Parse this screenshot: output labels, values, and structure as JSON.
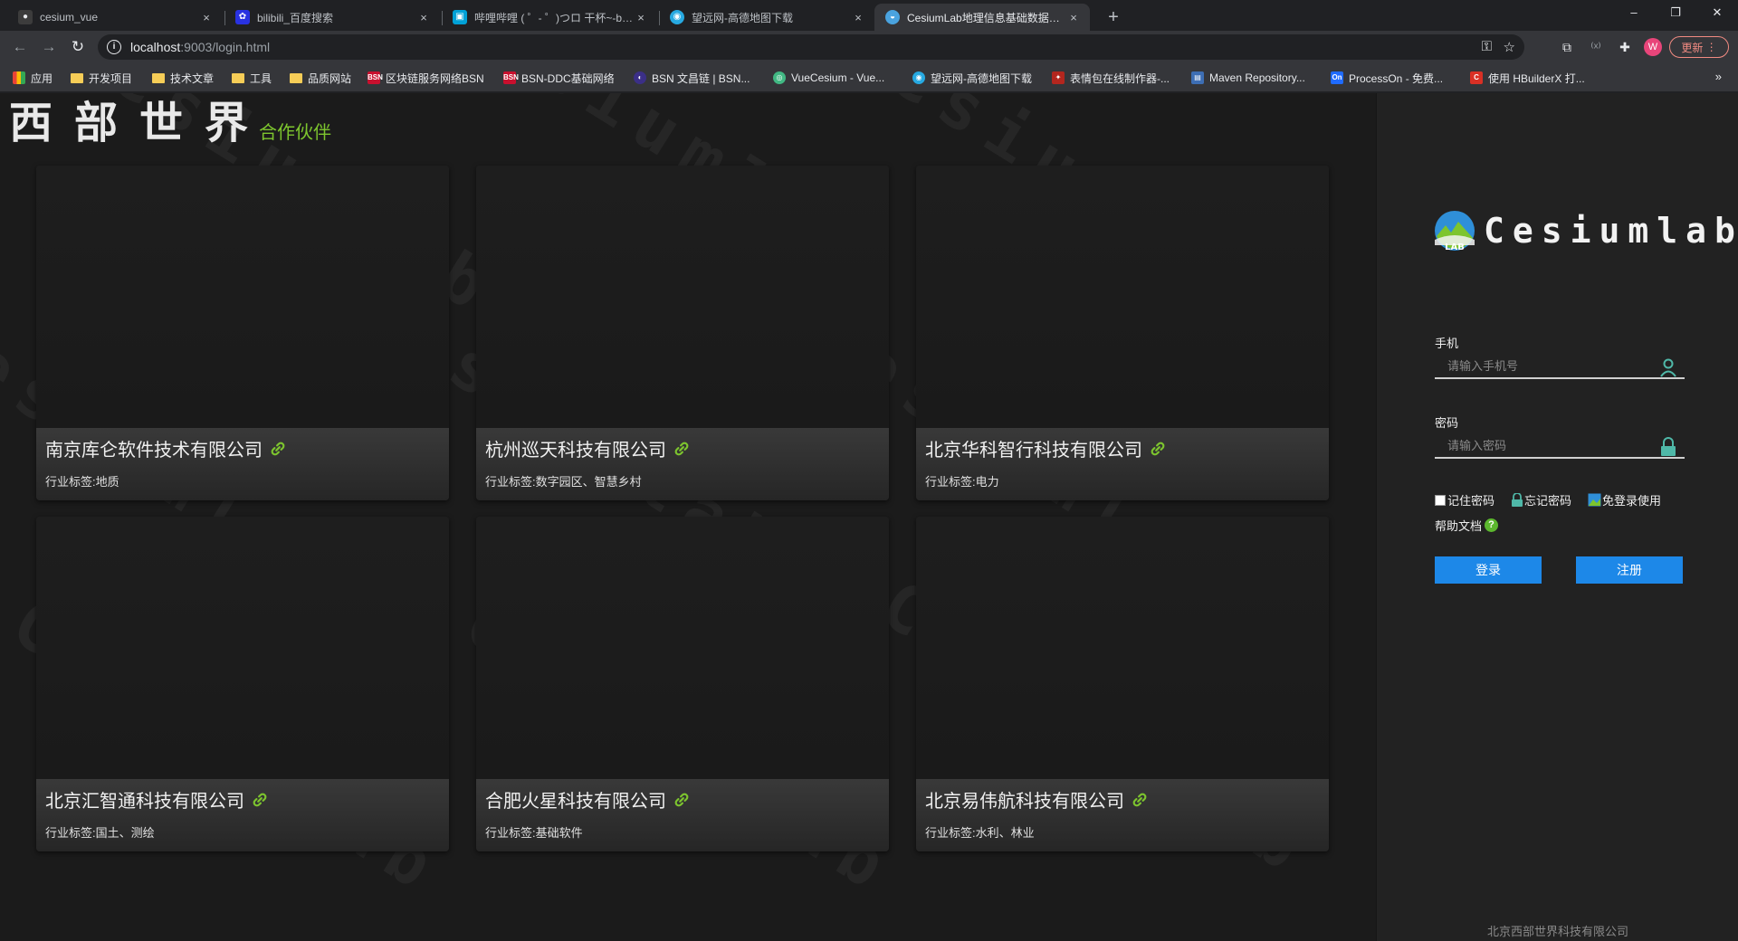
{
  "tabs": [
    {
      "title": "cesium_vue",
      "icon": "github-icon",
      "color": "#9aa0a6"
    },
    {
      "title": "bilibili_百度搜索",
      "icon": "baidu-icon",
      "color": "#2932e1"
    },
    {
      "title": "哔哩哔哩 ( ゜- ゜)つロ 干杯~-bilibili",
      "icon": "bilibili-icon",
      "color": "#00a1d6"
    },
    {
      "title": "望远网-高德地图下载",
      "icon": "globe-icon",
      "color": "#27a9e1"
    },
    {
      "title": "CesiumLab地理信息基础数据处理",
      "icon": "cesiumlab-icon",
      "color": "#4aa3df",
      "active": true
    }
  ],
  "tab_close": "×",
  "new_tab": "+",
  "window": {
    "minimize": "–",
    "restore": "❐",
    "close": "✕"
  },
  "address": {
    "host": "localhost",
    "path": ":9003/login.html"
  },
  "toolbar": {
    "avatar_letter": "W",
    "update_label": "更新"
  },
  "bookmarks": [
    {
      "label": "应用",
      "type": "apps"
    },
    {
      "label": "开发项目",
      "type": "folder"
    },
    {
      "label": "技术文章",
      "type": "folder"
    },
    {
      "label": "工具",
      "type": "folder"
    },
    {
      "label": "品质网站",
      "type": "folder"
    },
    {
      "label": "区块链服务网络BSN",
      "type": "site",
      "color": "#c8102e",
      "glyph": "BSN"
    },
    {
      "label": "BSN-DDC基础网络",
      "type": "site",
      "color": "#c8102e",
      "glyph": "BSN"
    },
    {
      "label": "BSN 文昌链 | BSN...",
      "type": "site",
      "color": "#3b2f87",
      "glyph": "◐"
    },
    {
      "label": "VueCesium - Vue...",
      "type": "site",
      "color": "#41b883",
      "glyph": "◎"
    },
    {
      "label": "望远网-高德地图下载",
      "type": "site",
      "color": "#27a9e1",
      "glyph": "◉"
    },
    {
      "label": "表情包在线制作器-...",
      "type": "site",
      "color": "#b3261e",
      "glyph": "✦"
    },
    {
      "label": "Maven Repository...",
      "type": "site",
      "color": "#3d6eb4",
      "glyph": "▤"
    },
    {
      "label": "ProcessOn - 免费...",
      "type": "site",
      "color": "#1f6bff",
      "glyph": "On"
    },
    {
      "label": "使用 HBuilderX 打...",
      "type": "site",
      "color": "#d93025",
      "glyph": "C"
    }
  ],
  "bookmarks_more": "»",
  "site": {
    "logo": "西部世界",
    "logo_sub": "合作伙伴",
    "watermark": "Cesiumlab"
  },
  "partners": [
    {
      "name": "南京库仑软件技术有限公司",
      "tag": "行业标签:地质"
    },
    {
      "name": "杭州巡天科技有限公司",
      "tag": "行业标签:数字园区、智慧乡村"
    },
    {
      "name": "北京华科智行科技有限公司",
      "tag": "行业标签:电力"
    },
    {
      "name": "北京汇智通科技有限公司",
      "tag": "行业标签:国土、测绘"
    },
    {
      "name": "合肥火星科技有限公司",
      "tag": "行业标签:基础软件"
    },
    {
      "name": "北京易伟航科技有限公司",
      "tag": "行业标签:水利、林业"
    }
  ],
  "login": {
    "brand": "Cesiumlab",
    "phone_label": "手机",
    "phone_placeholder": "请输入手机号",
    "password_label": "密码",
    "password_placeholder": "请输入密码",
    "remember": "记住密码",
    "forgot": "忘记密码",
    "no_login": "免登录使用",
    "help": "帮助文档",
    "help_icon": "?",
    "login_button": "登录",
    "register_button": "注册",
    "company": "北京西部世界科技有限公司"
  },
  "colors": {
    "accent_green": "#7dc52e",
    "button_blue": "#1d88e8"
  }
}
